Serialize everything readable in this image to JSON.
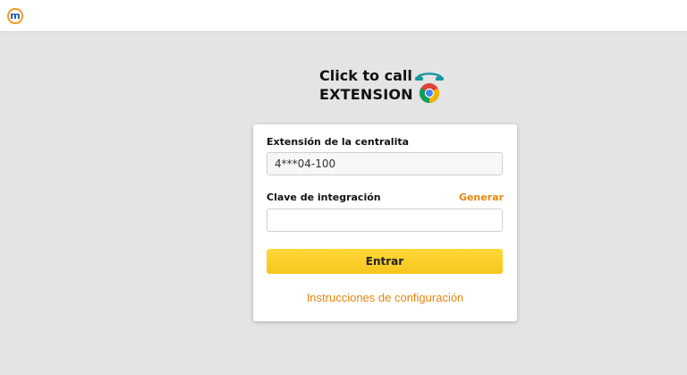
{
  "header": {
    "app_icon": "m-logo-icon",
    "app_icon_letter": "m"
  },
  "brand": {
    "line1": "Click to call",
    "line2": "EXTENSION",
    "icons": [
      "phone-icon",
      "chrome-icon"
    ]
  },
  "form": {
    "extension_label": "Extensión de la centralita",
    "extension_value": "4***04-100",
    "key_label": "Clave de integración",
    "generate_link": "Generar",
    "key_value": "",
    "submit_label": "Entrar",
    "instructions_link": "Instrucciones de configuración"
  },
  "colors": {
    "accent": "#e8860c",
    "button": "#f7c51d",
    "background": "#e4e4e4"
  }
}
